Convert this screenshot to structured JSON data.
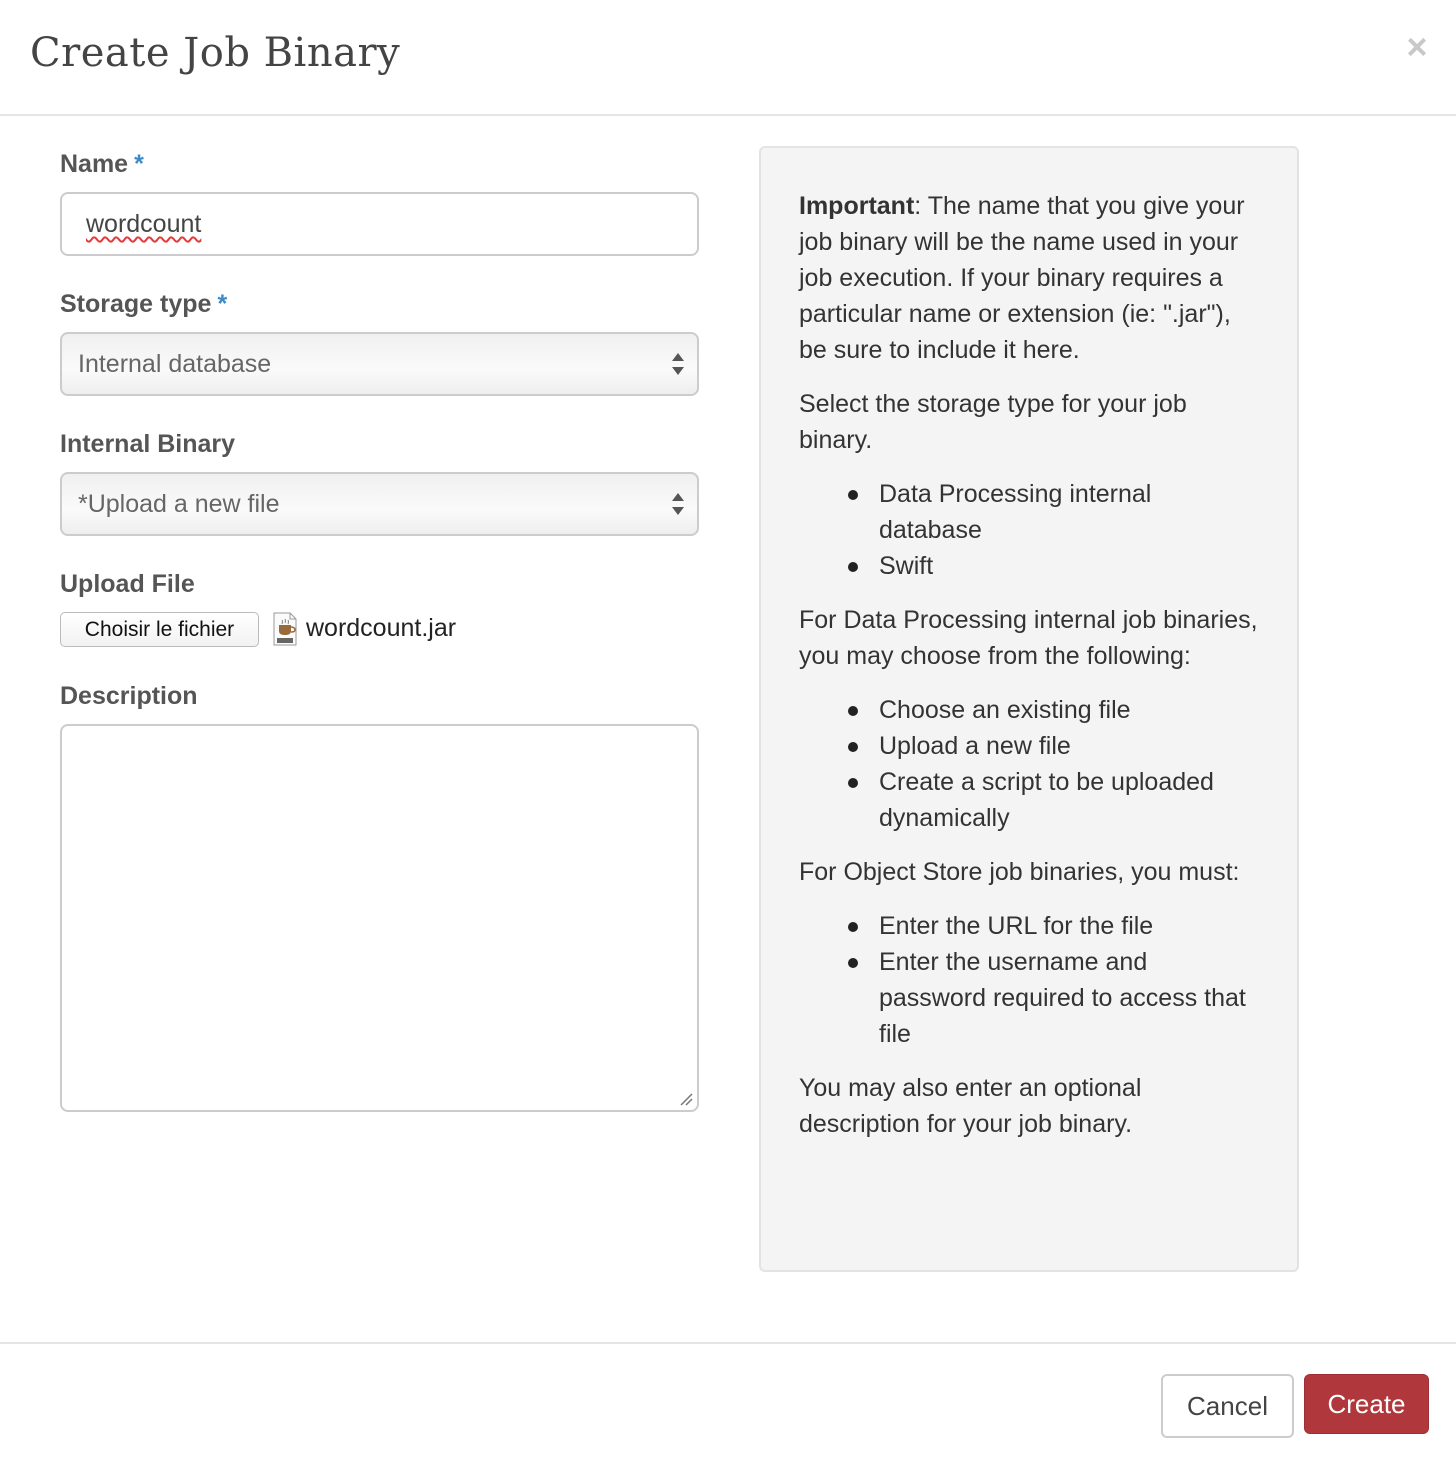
{
  "dialog": {
    "title": "Create Job Binary",
    "close_label": "×"
  },
  "form": {
    "name": {
      "label": "Name",
      "required_mark": "*",
      "value": "wordcount"
    },
    "storage_type": {
      "label": "Storage type",
      "required_mark": "*",
      "selected": "Internal database"
    },
    "internal_binary": {
      "label": "Internal Binary",
      "selected": "*Upload a new file"
    },
    "upload_file": {
      "label": "Upload File",
      "button_label": "Choisir le fichier",
      "file_name": "wordcount.jar"
    },
    "description": {
      "label": "Description",
      "value": ""
    }
  },
  "help": {
    "intro_bold": "Important",
    "intro_rest": ": The name that you give your job binary will be the name used in your job execution. If your binary requires a particular name or extension (ie: \".jar\"), be sure to include it here.",
    "storage_intro": "Select the storage type for your job binary.",
    "storage_options": [
      "Data Processing internal database",
      "Swift"
    ],
    "internal_intro": "For Data Processing internal job binaries, you may choose from the following:",
    "internal_options": [
      "Choose an existing file",
      "Upload a new file",
      "Create a script to be uploaded dynamically"
    ],
    "object_intro": "For Object Store job binaries, you must:",
    "object_options": [
      "Enter the URL for the file",
      "Enter the username and password required to access that file"
    ],
    "outro": "You may also enter an optional description for your job binary."
  },
  "footer": {
    "cancel_label": "Cancel",
    "create_label": "Create"
  },
  "colors": {
    "required_mark": "#3a8ac8",
    "create_button": "#b0383c"
  }
}
